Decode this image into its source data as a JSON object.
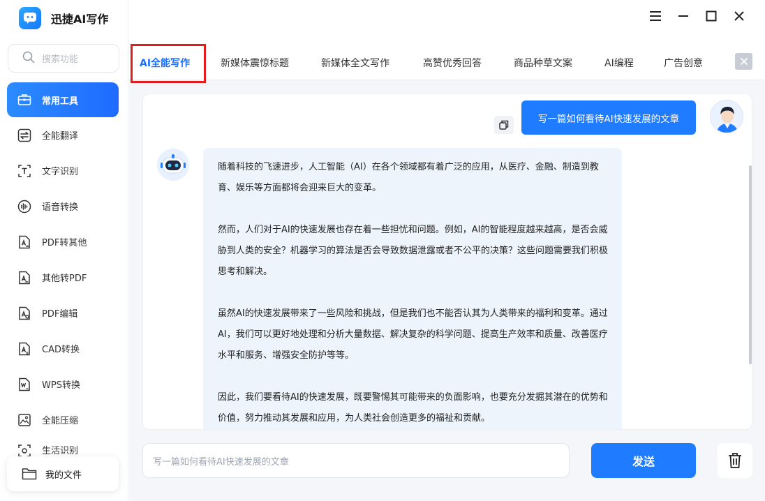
{
  "app": {
    "title": "迅捷AI写作",
    "logo_icon": "chat-bubble-icon",
    "accent": "#1f7bff"
  },
  "window_controls": [
    {
      "icon": "menu-icon"
    },
    {
      "icon": "minimize-icon"
    },
    {
      "icon": "maximize-icon"
    },
    {
      "icon": "close-icon"
    }
  ],
  "sidebar": {
    "search_placeholder": "搜索功能",
    "items": [
      {
        "label": "常用工具",
        "icon": "toolbox-icon",
        "active": true
      },
      {
        "label": "全能翻译",
        "icon": "translate-icon"
      },
      {
        "label": "文字识别",
        "icon": "text-recognition-icon"
      },
      {
        "label": "语音转换",
        "icon": "audio-wave-icon"
      },
      {
        "label": "PDF转其他",
        "icon": "pdf-convert-icon"
      },
      {
        "label": "其他转PDF",
        "icon": "to-pdf-icon"
      },
      {
        "label": "PDF编辑",
        "icon": "pdf-edit-icon"
      },
      {
        "label": "CAD转换",
        "icon": "cad-convert-icon"
      },
      {
        "label": "WPS转换",
        "icon": "wps-convert-icon"
      },
      {
        "label": "全能压缩",
        "icon": "compress-icon"
      },
      {
        "label": "生活识别",
        "icon": "scan-icon"
      }
    ],
    "my_files": "我的文件"
  },
  "tabs": [
    {
      "label": "AI全能写作",
      "active": true
    },
    {
      "label": "新媒体震惊标题"
    },
    {
      "label": "新媒体全文写作"
    },
    {
      "label": "高赞优秀回答"
    },
    {
      "label": "商品种草文案"
    },
    {
      "label": "AI编程"
    },
    {
      "label": "广告创意"
    }
  ],
  "chat": {
    "user_message": "写一篇如何看待AI快速发展的文章",
    "answer_paragraphs": [
      "随着科技的飞速进步，人工智能（AI）在各个领域都有着广泛的应用，从医疗、金融、制造到教育、娱乐等方面都将会迎来巨大的变革。",
      "然而，人们对于AI的快速发展也存在着一些担忧和问题。例如，AI的智能程度越来越高，是否会威胁到人类的安全？机器学习的算法是否会导致数据泄露或者不公平的决策？这些问题需要我们积极思考和解决。",
      "虽然AI的快速发展带来了一些风险和挑战，但是我们也不能否认其为人类带来的福利和变革。通过AI，我们可以更好地处理和分析大量数据、解决复杂的科学问题、提高生产效率和质量、改善医疗水平和服务、增强安全防护等等。",
      "因此，我们要看待AI的快速发展，既要警惕其可能带来的负面影响，也要充分发掘其潜在的优势和价值，努力推动其发展和应用，为人类社会创造更多的福祉和贡献。"
    ]
  },
  "composer": {
    "input_value": "写一篇如何看待AI快速发展的文章",
    "send_label": "发送"
  }
}
